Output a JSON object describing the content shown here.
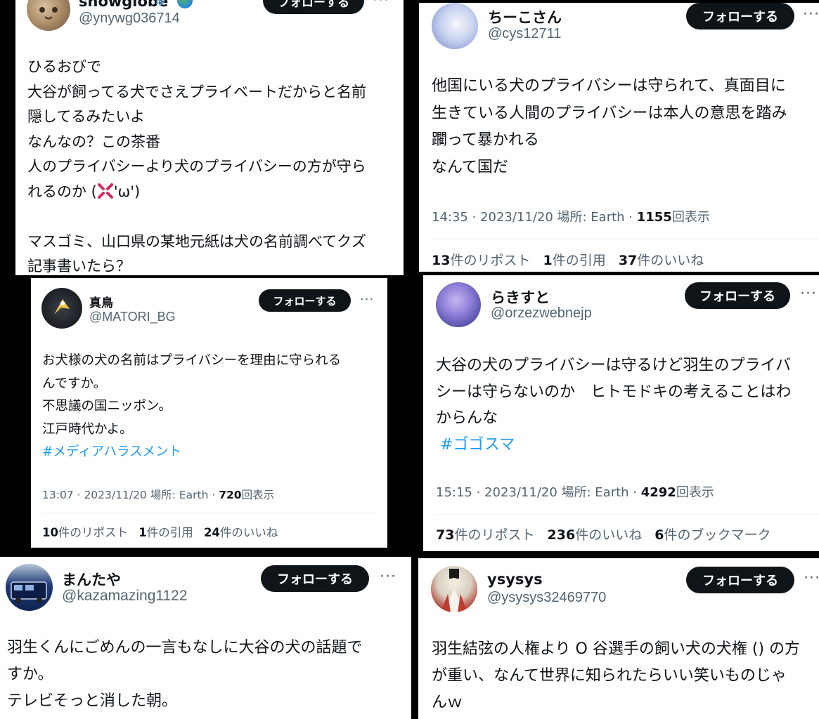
{
  "follow_label": "フォローする",
  "more_glyph": "···",
  "hashtag_color": "#1d9bf0",
  "cards": {
    "snowglobe": {
      "name": "snowglobe",
      "handle": "@ynywg036714",
      "lines": [
        "ひるおびで",
        "大谷が飼ってる犬でさえプライベートだからと名前",
        "隠してるみたいよ",
        "なんなの？この茶番",
        "人のプライバシーより犬のプライバシーの方が守ら",
        "れるのか (",
        "'ω')",
        "",
        "マスゴミ、山口県の某地元紙は犬の名前調べてクズ",
        "記事書いたら？"
      ],
      "avatar_icon": "cat-avatar-icon",
      "badge_icons": [
        "snowflake-icon",
        "earth-globe-icon"
      ],
      "inline_icon": "anger-symbol-icon"
    },
    "chiko": {
      "name": "ちーこさん",
      "handle": "@cys12711",
      "lines": [
        "他国にいる犬のプライバシーは守られて、真面目に",
        "生きている人間のプライバシーは本人の意思を踏み",
        "躙って暴かれる",
        "なんて国だ"
      ],
      "meta_prefix": "14:35 · 2023/11/20 場所: Earth · ",
      "views": "1155",
      "views_label": "回表示",
      "stats": [
        {
          "n": "13",
          "label": "件のリポスト"
        },
        {
          "n": "1",
          "label": "件の引用"
        },
        {
          "n": "37",
          "label": "件のいいね"
        }
      ]
    },
    "matori": {
      "name": "真鳥",
      "handle": "@MATORI_BG",
      "lines": [
        "お犬様の犬の名前はプライバシーを理由に守られる",
        "んですか。",
        "不思議の国ニッポン。",
        "江戸時代かよ。"
      ],
      "hashtag": "#メディアハラスメント",
      "meta_prefix": "13:07 · 2023/11/20 場所: Earth · ",
      "views": "720",
      "views_label": "回表示",
      "stats": [
        {
          "n": "10",
          "label": "件のリポスト"
        },
        {
          "n": "1",
          "label": "件の引用"
        },
        {
          "n": "24",
          "label": "件のいいね"
        }
      ]
    },
    "rakisuto": {
      "name": "らきすと",
      "handle": "@orzezwebnejp",
      "lines": [
        "大谷の犬のプライバシーは守るけど羽生のプライバ",
        "シーは守らないのか　ヒトモドキの考えることはわ",
        "からんな"
      ],
      "hashtag": "#ゴゴスマ",
      "meta_prefix": "15:15 · 2023/11/20 場所: Earth · ",
      "views": "4292",
      "views_label": "回表示",
      "stats": [
        {
          "n": "73",
          "label": "件のリポスト"
        },
        {
          "n": "236",
          "label": "件のいいね"
        },
        {
          "n": "6",
          "label": "件のブックマーク"
        }
      ]
    },
    "mantaya": {
      "name": "まんたや",
      "handle": "@kazamazing1122",
      "lines": [
        "羽生くんにごめんの一言もなしに大谷の犬の話題で",
        "すか。",
        "テレビそっと消した朝。"
      ]
    },
    "ysysys": {
      "name": "ysysys",
      "handle": "@ysysys32469770",
      "lines": [
        "羽生結弦の人権より O 谷選手の飼い犬の犬権 () の方",
        "が重い、なんて世界に知られたらいい笑いものじゃ",
        "んｗ"
      ]
    }
  }
}
